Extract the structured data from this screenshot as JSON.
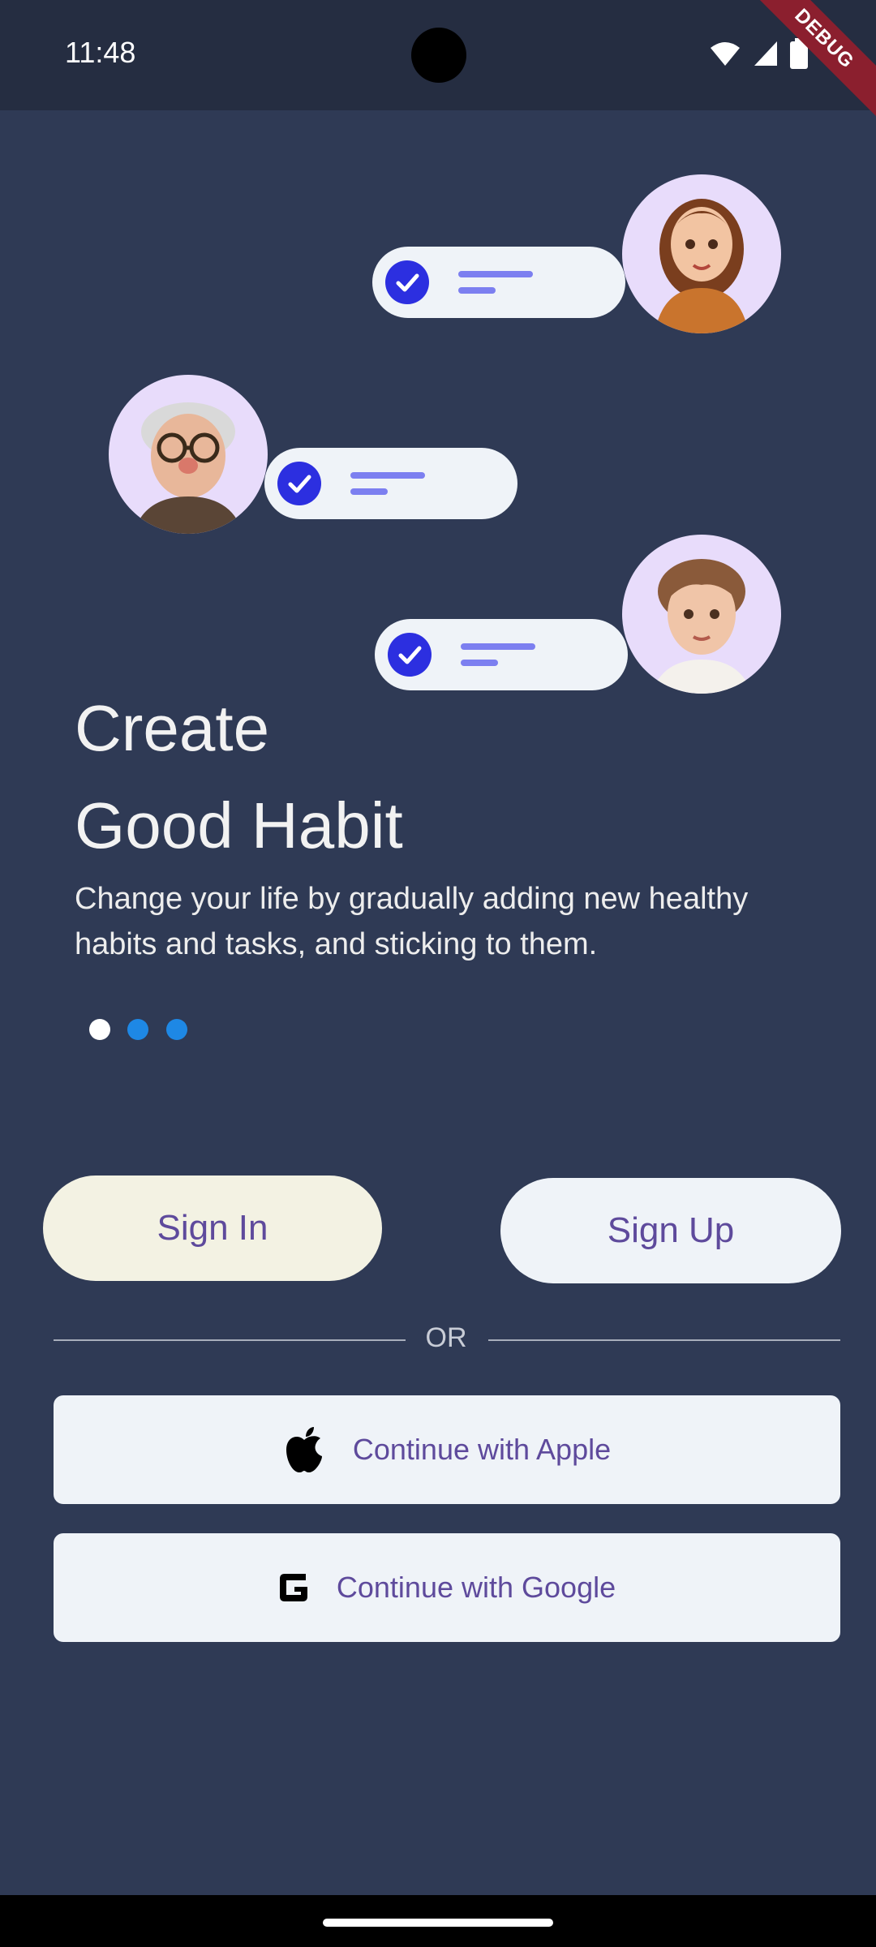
{
  "status_bar": {
    "time": "11:48",
    "debug_label": "DEBUG"
  },
  "onboarding": {
    "title_line1": "Create",
    "title_line2": "Good Habit",
    "subtitle": "Change your life by gradually adding new healthy habits and tasks, and sticking to them.",
    "page_indicator": {
      "total": 3,
      "active": 1
    }
  },
  "auth": {
    "sign_in_label": "Sign In",
    "sign_up_label": "Sign Up",
    "or_label": "OR",
    "apple_label": "Continue with Apple",
    "google_label": "Continue with Google"
  },
  "colors": {
    "background": "#2F3A55",
    "accent_purple": "#5E4A9C",
    "check_blue": "#2C2FE0",
    "dot_active": "#FFFFFF",
    "dot_inactive": "#1E88E5"
  }
}
